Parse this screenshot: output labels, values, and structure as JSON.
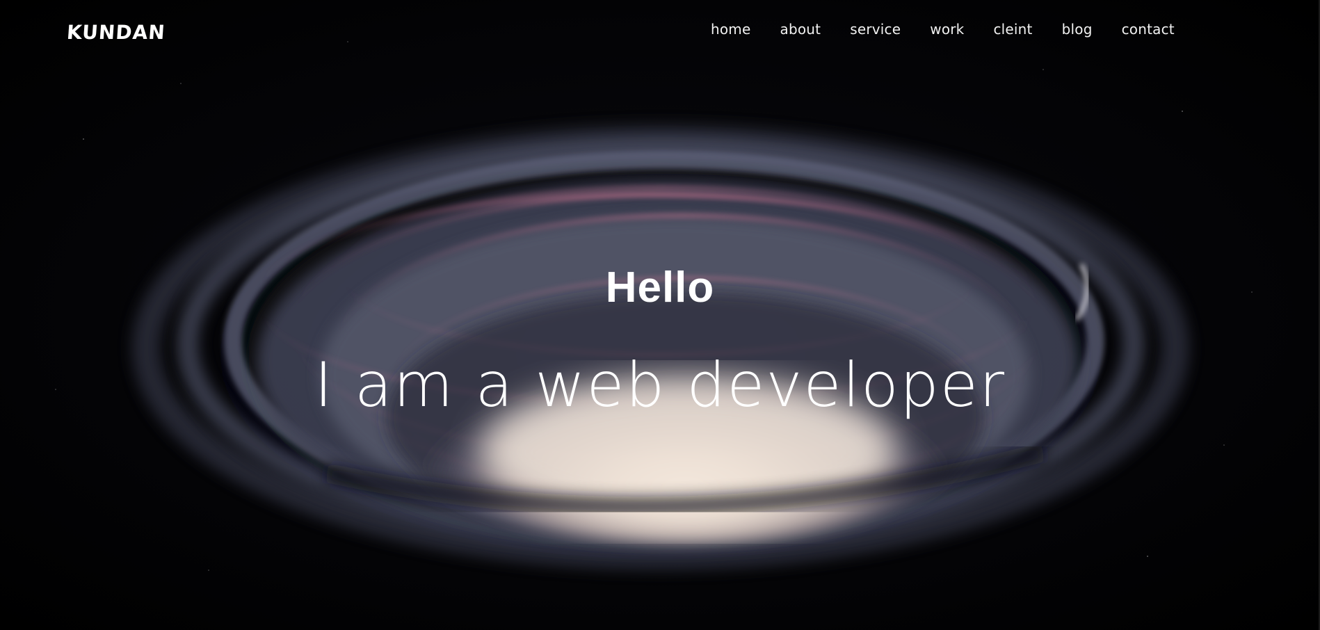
{
  "header": {
    "logo": "KUNDAN",
    "nav": [
      {
        "label": "home"
      },
      {
        "label": "about"
      },
      {
        "label": "service"
      },
      {
        "label": "work"
      },
      {
        "label": "cleint"
      },
      {
        "label": "blog"
      },
      {
        "label": "contact"
      }
    ]
  },
  "hero": {
    "greeting": "Hello",
    "subtitle": "I am a web developer",
    "background_icon": "galaxy-vortex-image"
  },
  "colors": {
    "background": "#000000",
    "text": "#ffffff"
  }
}
